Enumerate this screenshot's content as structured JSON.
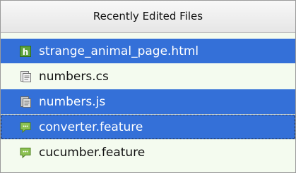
{
  "header": {
    "title": "Recently Edited Files"
  },
  "files": [
    {
      "name": "strange_animal_page.html",
      "icon": "html-file-icon",
      "selected": true
    },
    {
      "name": "numbers.cs",
      "icon": "script-file-icon",
      "selected": false
    },
    {
      "name": "numbers.js",
      "icon": "script-file-icon",
      "selected": true
    },
    {
      "name": "converter.feature",
      "icon": "feature-file-icon",
      "selected": true,
      "focused": true
    },
    {
      "name": "cucumber.feature",
      "icon": "feature-file-icon",
      "selected": false
    }
  ],
  "colors": {
    "selection": "#3470d8",
    "list_background": "#f4fbef",
    "header_background": "#eaeaea"
  }
}
